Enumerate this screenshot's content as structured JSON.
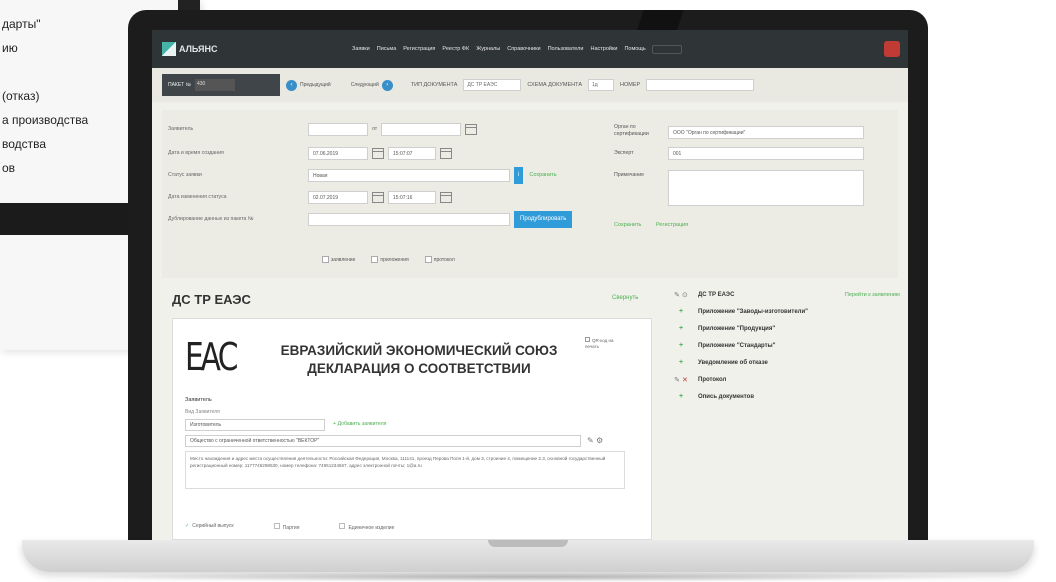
{
  "left_menu": {
    "items": [
      "дарты\"",
      "ию",
      "",
      "(отказ)",
      "а производства",
      "водства",
      "ов"
    ]
  },
  "app": {
    "logo_text": "АЛЬЯНС",
    "nav": [
      "Заявки",
      "Письма",
      "Регистрация",
      "Реестр ФК",
      "Журналы",
      "Справочники",
      "Пользователи",
      "Настройки",
      "Помощь"
    ],
    "filter": {
      "pack_label": "ПАКЕТ №",
      "pack_value": "430",
      "prev_label": "Предыдущий",
      "next_label": "Следующий",
      "doc_type_label": "ТИП ДОКУМЕНТА",
      "doc_type_value": "ДС ТР ЕАЭС",
      "scheme_label": "СХЕМА ДОКУМЕНТА",
      "scheme_value": "1д",
      "number_label": "НОМЕР",
      "number_value": ""
    },
    "form": {
      "applicant_label": "Заявитель",
      "applicant_from": "от",
      "created_label": "Дата и время создания",
      "created_date": "07.06.2019",
      "created_time": "15:07:07",
      "status_label": "Статус заявки",
      "status_value": "Новая",
      "save_label": "Сохранить",
      "status_changed_label": "Дата изменения статуса",
      "status_changed_date": "02.07.2019",
      "status_changed_time": "15:07:16",
      "duplicate_label": "Дублирование данных из пакета №",
      "reproduce_button": "Продублировать",
      "checks": [
        "заявление",
        "приложения",
        "протокол"
      ],
      "organ_label": "Орган по сертификации",
      "organ_value": "ООО \"Орган по сертификации\"",
      "expert_label": "Эксперт",
      "expert_value": "001",
      "note_label": "Примечание",
      "save_link": "Сохранить",
      "registration_link": "Регистрация"
    },
    "document": {
      "title": "ДС ТР ЕАЭС",
      "collapse_link": "Свернуть",
      "eac_mark": "ЕАС",
      "heading_1": "ЕВРАЗИЙСКИЙ ЭКОНОМИЧЕСКИЙ СОЮЗ",
      "heading_2": "ДЕКЛАРАЦИЯ О СООТВЕТСТВИИ",
      "qr_label": "QR-код на печать",
      "applicant_label": "Заявитель",
      "applicant_kind_label": "Вид Заявителя",
      "applicant_kind_value": "Изготовитель",
      "add_applicant": "Добавить заявителя",
      "org_value": "Общество с ограниченной ответственностью \"ВЕКТОР\"",
      "address_text": "Место нахождения и адрес места осуществления деятельности: Российская Федерация, Москва, 111141, проезд Перова Поля 1-й, дом 3, строение 4, помещение 2.3, основной государственный регистрационный номер: 1177746298530, номер телефона: 74951234567, адрес электронной почты: 1@a.ru",
      "check_serial": "Серийный выпуск",
      "check_batch": "Партия",
      "check_single": "Единичное изделие"
    },
    "tree": [
      {
        "label": "ДС ТР ЕАЭС",
        "icon": "pencil-icon",
        "link": "Перейти к заявлению"
      },
      {
        "label": "Приложение \"Заводы-изготовители\"",
        "icon": "plus-icon"
      },
      {
        "label": "Приложение \"Продукция\"",
        "icon": "plus-icon"
      },
      {
        "label": "Приложение \"Стандарты\"",
        "icon": "plus-icon"
      },
      {
        "label": "Уведомление об отказе",
        "icon": "plus-icon"
      },
      {
        "label": "Протокол",
        "icon": "pencil-delete-icon"
      },
      {
        "label": "Опись документов",
        "icon": "plus-icon"
      }
    ]
  }
}
